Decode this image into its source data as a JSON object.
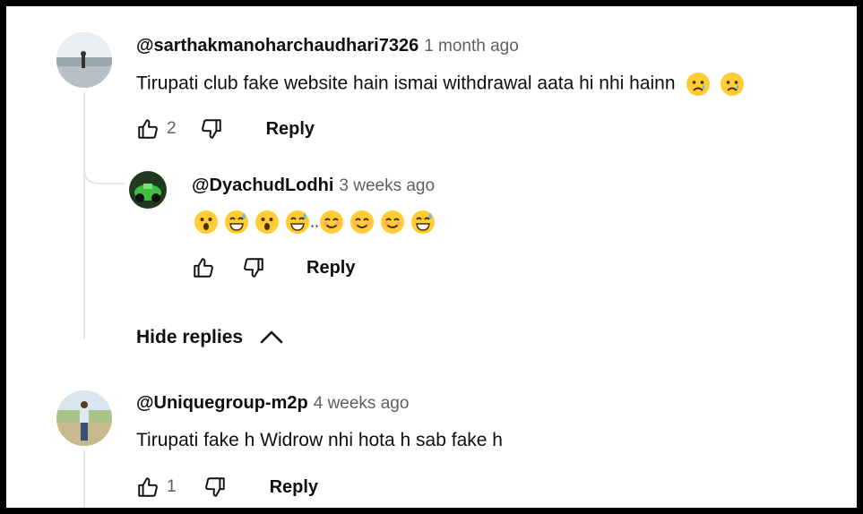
{
  "comments": [
    {
      "author": "@sarthakmanoharchaudhari7326",
      "time": "1 month ago",
      "text": "Tirupati club fake website hain ismai withdrawal aata hi nhi hainn",
      "text_emoji": [
        "crying-face",
        "crying-face"
      ],
      "likes": "2",
      "reply_label": "Reply"
    },
    {
      "author": "@Uniquegroup-m2p",
      "time": "4 weeks ago",
      "text": "Tirupati fake h Widrow nhi hota h sab fake h",
      "likes": "1",
      "reply_label": "Reply"
    }
  ],
  "reply": {
    "author": "@DyachudLodhi",
    "time": "3 weeks ago",
    "emoji": [
      "hushed-face",
      "grinning-sweat-face",
      "hushed-face",
      "grinning-sweat-face",
      "smiling-face",
      "smiling-face",
      "smiling-face",
      "grinning-sweat-face"
    ],
    "emoji_separator": "..",
    "reply_label": "Reply"
  },
  "hide_replies": {
    "label": "Hide replies",
    "icon": "chevron-up-icon"
  },
  "colors": {
    "text": "#0f0f0f",
    "secondary": "#606060",
    "thread_line": "#e5e5e5",
    "emoji_face": "#ffcc33"
  }
}
